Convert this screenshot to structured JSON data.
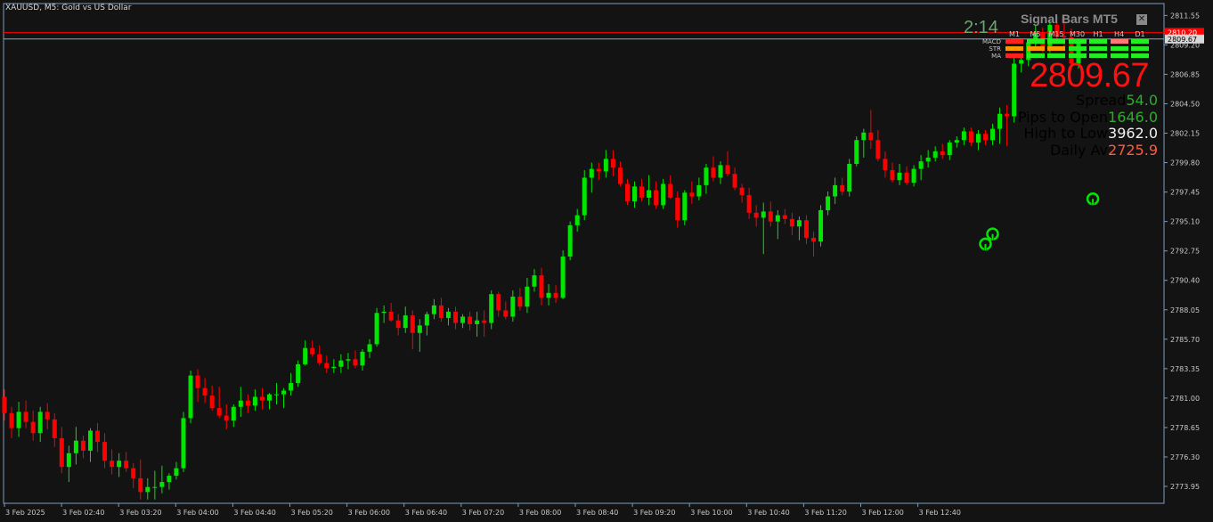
{
  "header": {
    "symbol_title": "XAUUSD, M5:  Gold vs US Dollar"
  },
  "colors": {
    "background": "#131313",
    "bull": "#00e600",
    "bear": "#ff0000",
    "axis": "#7f9cb8",
    "bid_line": "#ff0000",
    "ask_line": "#8aa8c8",
    "grid_text": "#c8c8c8"
  },
  "panel": {
    "name": "Signal Bars MT5",
    "close_icon": "close-icon",
    "timer": "2:14",
    "price": "2809.67",
    "timeframes": [
      "M1",
      "M5",
      "M15",
      "M30",
      "H1",
      "H4",
      "D1"
    ],
    "indicators": [
      {
        "name": "MACD",
        "cells": [
          "#ff2020",
          "#22ee22",
          "#22ee22",
          "#22ee22",
          "#22ee22",
          "#ff7777",
          "#22ee22"
        ]
      },
      {
        "name": "STR",
        "cells": [
          "#ff9900",
          "#ff9900",
          "#ff9900",
          "#22ee22",
          "#22ee22",
          "#22ee22",
          "#22ee22"
        ]
      },
      {
        "name": "MA",
        "cells": [
          "#ff2020",
          "#22ee22",
          "#22ee22",
          "#22ee22",
          "#22ee22",
          "#22ee22",
          "#22ee22"
        ]
      }
    ],
    "stats": [
      {
        "label": "Spread",
        "value": "54.0",
        "color": "#2eaa2e"
      },
      {
        "label": "Pips to Open",
        "value": "1646.0",
        "color": "#2eaa2e"
      },
      {
        "label": "High to Low",
        "value": "3962.0",
        "color": "#f0f0f0"
      },
      {
        "label": "Daily Av",
        "value": "2725.9",
        "color": "#ff5a40"
      }
    ]
  },
  "chart_data": {
    "type": "candlestick",
    "title": "XAUUSD, M5:  Gold vs US Dollar",
    "ylim": [
      2772.6,
      2812.5
    ],
    "y_ticks": [
      "2811.55",
      "2809.20",
      "2806.85",
      "2804.50",
      "2802.15",
      "2799.80",
      "2797.45",
      "2795.10",
      "2792.75",
      "2790.40",
      "2788.05",
      "2785.70",
      "2783.35",
      "2781.00",
      "2778.65",
      "2776.30",
      "2773.95"
    ],
    "x_ticks": [
      "3 Feb 2025",
      "3 Feb 02:40",
      "3 Feb 03:20",
      "3 Feb 04:00",
      "3 Feb 04:40",
      "3 Feb 05:20",
      "3 Feb 06:00",
      "3 Feb 06:40",
      "3 Feb 07:20",
      "3 Feb 08:00",
      "3 Feb 08:40",
      "3 Feb 09:20",
      "3 Feb 10:00",
      "3 Feb 10:40",
      "3 Feb 11:20",
      "3 Feb 12:00",
      "3 Feb 12:40"
    ],
    "bid_price": "2809.67",
    "ask_price": "2810.20",
    "grid": false,
    "arrows": [
      {
        "bar": 137,
        "price": 2794.3
      },
      {
        "bar": 138,
        "price": 2795.1
      },
      {
        "bar": 152,
        "price": 2797.9
      }
    ],
    "candles": [
      [
        2781.1,
        2781.7,
        2779.2,
        2779.8
      ],
      [
        2779.8,
        2780.3,
        2777.8,
        2778.6
      ],
      [
        2778.6,
        2780.7,
        2777.9,
        2779.9
      ],
      [
        2779.9,
        2780.8,
        2778.6,
        2779.1
      ],
      [
        2779.1,
        2780.0,
        2777.6,
        2778.2
      ],
      [
        2778.2,
        2780.3,
        2777.5,
        2779.9
      ],
      [
        2779.9,
        2780.6,
        2778.5,
        2779.3
      ],
      [
        2779.3,
        2779.8,
        2777.1,
        2777.8
      ],
      [
        2777.8,
        2778.7,
        2775.0,
        2775.5
      ],
      [
        2775.5,
        2777.2,
        2774.3,
        2776.6
      ],
      [
        2776.6,
        2778.7,
        2775.7,
        2777.6
      ],
      [
        2777.6,
        2778.0,
        2776.2,
        2776.8
      ],
      [
        2776.8,
        2778.6,
        2775.9,
        2778.4
      ],
      [
        2778.4,
        2779.0,
        2776.7,
        2777.5
      ],
      [
        2777.5,
        2778.2,
        2775.4,
        2776.0
      ],
      [
        2776.0,
        2776.9,
        2774.9,
        2775.5
      ],
      [
        2775.5,
        2776.6,
        2774.7,
        2776.0
      ],
      [
        2776.0,
        2776.7,
        2775.1,
        2775.4
      ],
      [
        2775.4,
        2775.8,
        2773.8,
        2774.6
      ],
      [
        2774.6,
        2776.1,
        2772.9,
        2773.5
      ],
      [
        2773.5,
        2774.6,
        2772.9,
        2773.9
      ],
      [
        2773.9,
        2775.2,
        2772.9,
        2773.9
      ],
      [
        2773.9,
        2775.6,
        2773.4,
        2774.3
      ],
      [
        2774.3,
        2775.0,
        2773.7,
        2774.8
      ],
      [
        2774.8,
        2775.9,
        2774.5,
        2775.4
      ],
      [
        2775.4,
        2779.9,
        2775.1,
        2779.4
      ],
      [
        2779.4,
        2783.2,
        2779.0,
        2782.8
      ],
      [
        2782.8,
        2783.3,
        2780.7,
        2781.8
      ],
      [
        2781.8,
        2782.6,
        2780.6,
        2781.2
      ],
      [
        2781.2,
        2782.0,
        2780.0,
        2780.2
      ],
      [
        2780.2,
        2781.9,
        2779.4,
        2779.6
      ],
      [
        2779.6,
        2780.5,
        2778.5,
        2779.2
      ],
      [
        2779.2,
        2780.5,
        2778.7,
        2780.3
      ],
      [
        2780.3,
        2781.9,
        2779.5,
        2780.8
      ],
      [
        2780.8,
        2781.3,
        2779.8,
        2780.4
      ],
      [
        2780.4,
        2781.7,
        2780.0,
        2781.1
      ],
      [
        2781.1,
        2781.8,
        2780.1,
        2780.8
      ],
      [
        2780.8,
        2781.4,
        2780.1,
        2781.3
      ],
      [
        2781.3,
        2782.2,
        2780.5,
        2781.3
      ],
      [
        2781.3,
        2781.8,
        2780.2,
        2781.6
      ],
      [
        2781.6,
        2783.0,
        2781.2,
        2782.2
      ],
      [
        2782.2,
        2784.0,
        2781.9,
        2783.7
      ],
      [
        2783.7,
        2785.6,
        2783.6,
        2785.0
      ],
      [
        2785.0,
        2785.6,
        2784.3,
        2784.5
      ],
      [
        2784.5,
        2785.2,
        2783.6,
        2783.8
      ],
      [
        2783.8,
        2784.4,
        2783.0,
        2783.4
      ],
      [
        2783.4,
        2784.1,
        2783.0,
        2783.5
      ],
      [
        2783.5,
        2784.5,
        2783.0,
        2784.0
      ],
      [
        2784.0,
        2784.6,
        2783.3,
        2784.1
      ],
      [
        2784.1,
        2784.8,
        2783.4,
        2783.6
      ],
      [
        2783.6,
        2784.9,
        2783.2,
        2784.7
      ],
      [
        2784.7,
        2785.7,
        2784.2,
        2785.3
      ],
      [
        2785.3,
        2788.2,
        2785.1,
        2787.8
      ],
      [
        2787.8,
        2788.4,
        2787.0,
        2787.9
      ],
      [
        2787.9,
        2788.6,
        2787.1,
        2787.2
      ],
      [
        2787.2,
        2787.7,
        2786.0,
        2786.6
      ],
      [
        2786.6,
        2788.3,
        2786.2,
        2787.6
      ],
      [
        2787.6,
        2788.0,
        2784.9,
        2786.2
      ],
      [
        2786.2,
        2787.3,
        2784.7,
        2786.8
      ],
      [
        2786.8,
        2787.9,
        2786.0,
        2787.7
      ],
      [
        2787.7,
        2788.9,
        2787.3,
        2788.4
      ],
      [
        2788.4,
        2789.0,
        2787.1,
        2787.4
      ],
      [
        2787.4,
        2788.2,
        2786.8,
        2787.9
      ],
      [
        2787.9,
        2788.3,
        2786.5,
        2787.0
      ],
      [
        2787.0,
        2787.7,
        2786.6,
        2787.5
      ],
      [
        2787.5,
        2787.9,
        2786.4,
        2786.9
      ],
      [
        2786.9,
        2787.9,
        2785.9,
        2787.2
      ],
      [
        2787.2,
        2788.0,
        2785.9,
        2787.0
      ],
      [
        2787.0,
        2789.6,
        2786.5,
        2789.3
      ],
      [
        2789.3,
        2789.5,
        2787.5,
        2788.0
      ],
      [
        2788.0,
        2788.7,
        2787.3,
        2787.5
      ],
      [
        2787.5,
        2789.6,
        2787.1,
        2789.1
      ],
      [
        2789.1,
        2789.8,
        2788.0,
        2788.3
      ],
      [
        2788.3,
        2790.6,
        2787.8,
        2789.9
      ],
      [
        2789.9,
        2791.3,
        2789.5,
        2790.8
      ],
      [
        2790.8,
        2791.4,
        2788.4,
        2789.0
      ],
      [
        2789.0,
        2790.1,
        2788.4,
        2789.4
      ],
      [
        2789.4,
        2790.0,
        2788.6,
        2789.0
      ],
      [
        2789.0,
        2792.8,
        2788.9,
        2792.3
      ],
      [
        2792.3,
        2795.1,
        2792.0,
        2794.8
      ],
      [
        2794.8,
        2796.1,
        2794.3,
        2795.6
      ],
      [
        2795.6,
        2799.2,
        2795.2,
        2798.6
      ],
      [
        2798.6,
        2799.8,
        2797.4,
        2799.3
      ],
      [
        2799.3,
        2799.8,
        2798.4,
        2799.1
      ],
      [
        2799.1,
        2800.8,
        2798.6,
        2800.1
      ],
      [
        2800.1,
        2800.8,
        2798.7,
        2799.4
      ],
      [
        2799.4,
        2799.9,
        2797.9,
        2798.1
      ],
      [
        2798.1,
        2798.5,
        2796.4,
        2796.7
      ],
      [
        2796.7,
        2798.3,
        2796.2,
        2797.9
      ],
      [
        2797.9,
        2798.5,
        2796.7,
        2797.0
      ],
      [
        2797.0,
        2798.8,
        2796.4,
        2797.6
      ],
      [
        2797.6,
        2798.3,
        2796.1,
        2796.4
      ],
      [
        2796.4,
        2798.5,
        2796.1,
        2798.1
      ],
      [
        2798.1,
        2798.8,
        2796.9,
        2797.0
      ],
      [
        2797.0,
        2797.5,
        2794.6,
        2795.2
      ],
      [
        2795.2,
        2797.6,
        2794.8,
        2797.4
      ],
      [
        2797.4,
        2798.3,
        2796.5,
        2797.1
      ],
      [
        2797.1,
        2798.6,
        2796.8,
        2798.0
      ],
      [
        2798.0,
        2799.7,
        2797.3,
        2799.4
      ],
      [
        2799.4,
        2800.3,
        2798.3,
        2798.6
      ],
      [
        2798.6,
        2799.9,
        2798.1,
        2799.6
      ],
      [
        2799.6,
        2800.7,
        2798.7,
        2798.9
      ],
      [
        2798.9,
        2799.4,
        2797.6,
        2797.8
      ],
      [
        2797.8,
        2798.1,
        2796.6,
        2797.2
      ],
      [
        2797.2,
        2797.8,
        2795.3,
        2795.8
      ],
      [
        2795.8,
        2796.4,
        2794.7,
        2795.4
      ],
      [
        2795.4,
        2796.6,
        2792.5,
        2795.9
      ],
      [
        2795.9,
        2796.7,
        2794.7,
        2795.1
      ],
      [
        2795.1,
        2796.0,
        2793.7,
        2795.6
      ],
      [
        2795.6,
        2796.1,
        2794.9,
        2795.3
      ],
      [
        2795.3,
        2795.8,
        2794.0,
        2794.7
      ],
      [
        2794.7,
        2795.5,
        2793.6,
        2795.2
      ],
      [
        2795.2,
        2795.6,
        2793.3,
        2793.8
      ],
      [
        2793.8,
        2794.3,
        2792.3,
        2793.5
      ],
      [
        2793.5,
        2796.4,
        2793.1,
        2796.0
      ],
      [
        2796.0,
        2797.5,
        2795.6,
        2797.1
      ],
      [
        2797.1,
        2798.6,
        2796.5,
        2798.0
      ],
      [
        2798.0,
        2798.6,
        2797.2,
        2797.5
      ],
      [
        2797.5,
        2800.1,
        2797.1,
        2799.7
      ],
      [
        2799.7,
        2801.9,
        2799.5,
        2801.6
      ],
      [
        2801.6,
        2802.5,
        2800.2,
        2802.2
      ],
      [
        2802.2,
        2804.0,
        2800.9,
        2801.6
      ],
      [
        2801.6,
        2802.4,
        2799.9,
        2800.1
      ],
      [
        2800.1,
        2800.7,
        2798.6,
        2799.2
      ],
      [
        2799.2,
        2799.8,
        2798.2,
        2798.4
      ],
      [
        2798.4,
        2799.7,
        2798.0,
        2799.0
      ],
      [
        2799.0,
        2799.5,
        2798.0,
        2798.2
      ],
      [
        2798.2,
        2799.6,
        2797.9,
        2799.3
      ],
      [
        2799.3,
        2800.4,
        2798.4,
        2799.9
      ],
      [
        2799.9,
        2800.8,
        2799.4,
        2800.2
      ],
      [
        2800.2,
        2801.1,
        2799.9,
        2800.7
      ],
      [
        2800.7,
        2801.3,
        2800.1,
        2800.4
      ],
      [
        2800.4,
        2801.6,
        2800.0,
        2801.4
      ],
      [
        2801.4,
        2801.9,
        2801.0,
        2801.6
      ],
      [
        2801.6,
        2802.6,
        2801.2,
        2802.3
      ],
      [
        2802.3,
        2802.6,
        2801.1,
        2801.4
      ],
      [
        2801.4,
        2802.4,
        2800.8,
        2802.1
      ],
      [
        2802.1,
        2802.4,
        2801.2,
        2801.6
      ],
      [
        2801.6,
        2802.9,
        2801.2,
        2802.5
      ],
      [
        2802.5,
        2804.2,
        2801.3,
        2803.7
      ],
      [
        2803.7,
        2804.4,
        2801.1,
        2803.5
      ],
      [
        2803.5,
        2808.2,
        2803.0,
        2807.7
      ],
      [
        2807.7,
        2808.5,
        2807.0,
        2808.0
      ],
      [
        2808.0,
        2809.7,
        2807.5,
        2809.4
      ],
      [
        2809.4,
        2810.8,
        2808.9,
        2810.2
      ],
      [
        2810.2,
        2810.6,
        2808.6,
        2809.1
      ],
      [
        2809.1,
        2811.2,
        2808.6,
        2810.8
      ],
      [
        2810.8,
        2811.5,
        2809.5,
        2809.9
      ],
      [
        2809.9,
        2811.6,
        2808.9,
        2809.8
      ],
      [
        2809.8,
        2810.5,
        2807.2,
        2807.7
      ],
      [
        2807.7,
        2809.5,
        2807.3,
        2809.3
      ]
    ]
  },
  "x_axis_labels": [
    "3 Feb 2025",
    "3 Feb 02:40",
    "3 Feb 03:20",
    "3 Feb 04:00",
    "3 Feb 04:40",
    "3 Feb 05:20",
    "3 Feb 06:00",
    "3 Feb 06:40",
    "3 Feb 07:20",
    "3 Feb 08:00",
    "3 Feb 08:40",
    "3 Feb 09:20",
    "3 Feb 10:00",
    "3 Feb 10:40",
    "3 Feb 11:20",
    "3 Feb 12:00",
    "3 Feb 12:40"
  ]
}
